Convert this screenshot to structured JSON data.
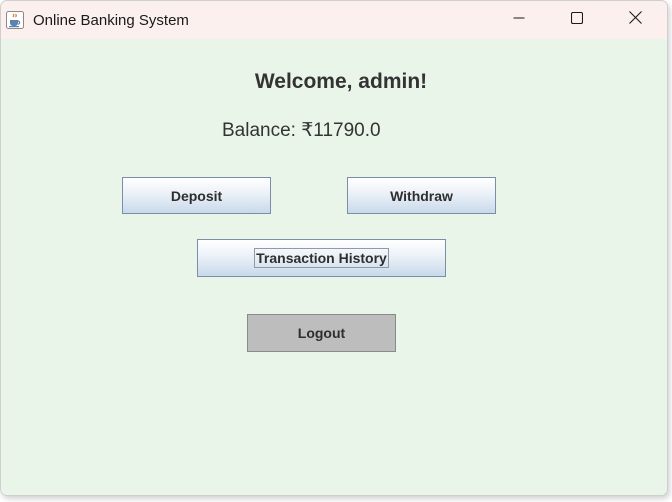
{
  "window": {
    "title": "Online Banking System",
    "app_icon": "java-coffee-cup-icon",
    "controls": {
      "minimize_icon": "minimize-icon",
      "maximize_icon": "maximize-icon",
      "close_icon": "close-icon"
    }
  },
  "dashboard": {
    "welcome": "Welcome, admin!",
    "balance": "Balance: ₹11790.0"
  },
  "buttons": {
    "deposit": "Deposit",
    "withdraw": "Withdraw",
    "transaction_history": "Transaction History",
    "logout": "Logout"
  },
  "colors": {
    "title_bar": "#fbf0ee",
    "content_background": "#e9f5e9",
    "button_gradient_bottom": "#c8d9ea",
    "logout_button": "#bdbdbd",
    "text": "#333333"
  }
}
